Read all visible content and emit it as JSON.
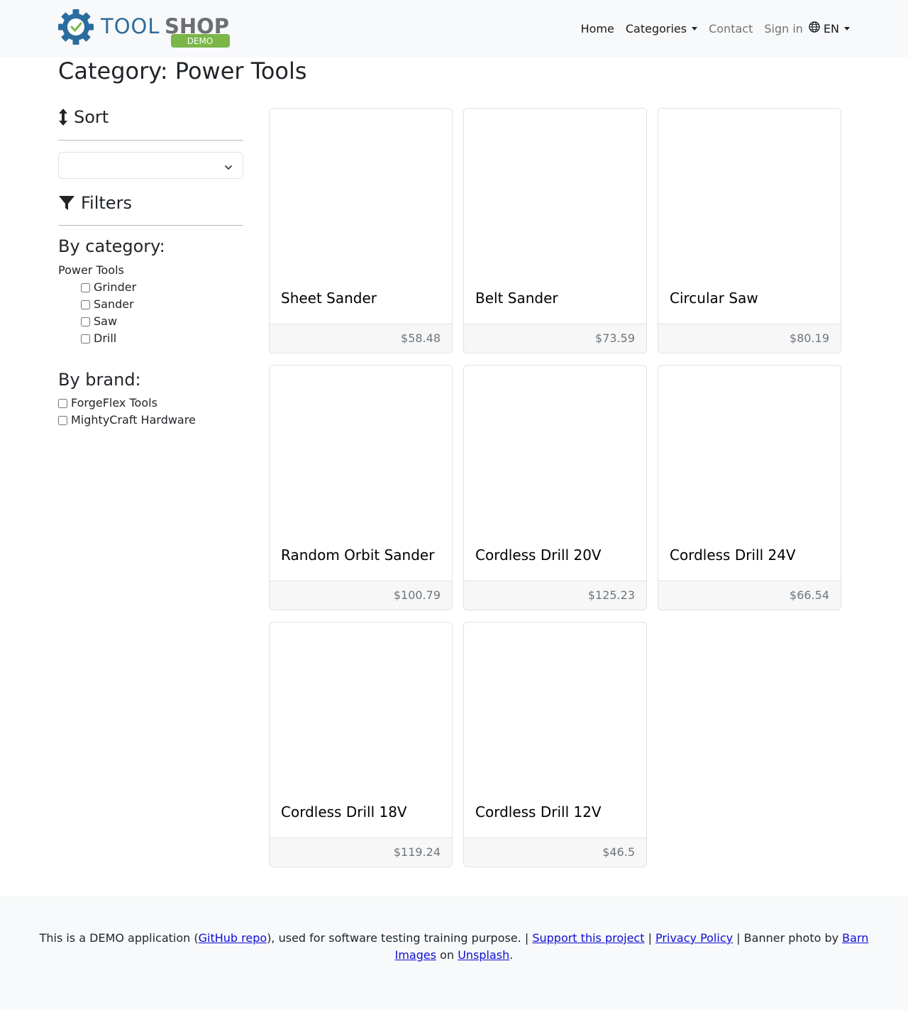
{
  "brand": {
    "logo_text_tool": "TOOL",
    "logo_text_shop": "SHOP",
    "logo_badge": "DEMO"
  },
  "nav": {
    "home": "Home",
    "categories": "Categories",
    "contact": "Contact",
    "sign_in": "Sign in",
    "language": "EN"
  },
  "page": {
    "title": "Category: Power Tools"
  },
  "sidebar": {
    "sort_heading": "Sort",
    "sort_select_value": "",
    "filters_heading": "Filters",
    "by_category_heading": "By category:",
    "category_root": "Power Tools",
    "categories": [
      "Grinder",
      "Sander",
      "Saw",
      "Drill"
    ],
    "by_brand_heading": "By brand:",
    "brands": [
      "ForgeFlex Tools",
      "MightyCraft Hardware"
    ]
  },
  "products": [
    {
      "name": "Sheet Sander",
      "price": "$58.48"
    },
    {
      "name": "Belt Sander",
      "price": "$73.59"
    },
    {
      "name": "Circular Saw",
      "price": "$80.19"
    },
    {
      "name": "Random Orbit Sander",
      "price": "$100.79"
    },
    {
      "name": "Cordless Drill 20V",
      "price": "$125.23"
    },
    {
      "name": "Cordless Drill 24V",
      "price": "$66.54"
    },
    {
      "name": "Cordless Drill 18V",
      "price": "$119.24"
    },
    {
      "name": "Cordless Drill 12V",
      "price": "$46.5"
    }
  ],
  "footer": {
    "text_1": "This is a DEMO application (",
    "github_link": "GitHub repo",
    "text_2": "), used for software testing training purpose. | ",
    "support_link": "Support this project",
    "text_3": " | ",
    "privacy_link": "Privacy Policy",
    "text_4": " | Banner photo by ",
    "barn_link": "Barn Images",
    "text_5": " on ",
    "unsplash_link": "Unsplash",
    "text_6": "."
  },
  "colors": {
    "logo_blue": "#2b6c9e",
    "logo_gray": "#6d6e71",
    "logo_green": "#7ab648",
    "link": "#0d0dd6"
  }
}
